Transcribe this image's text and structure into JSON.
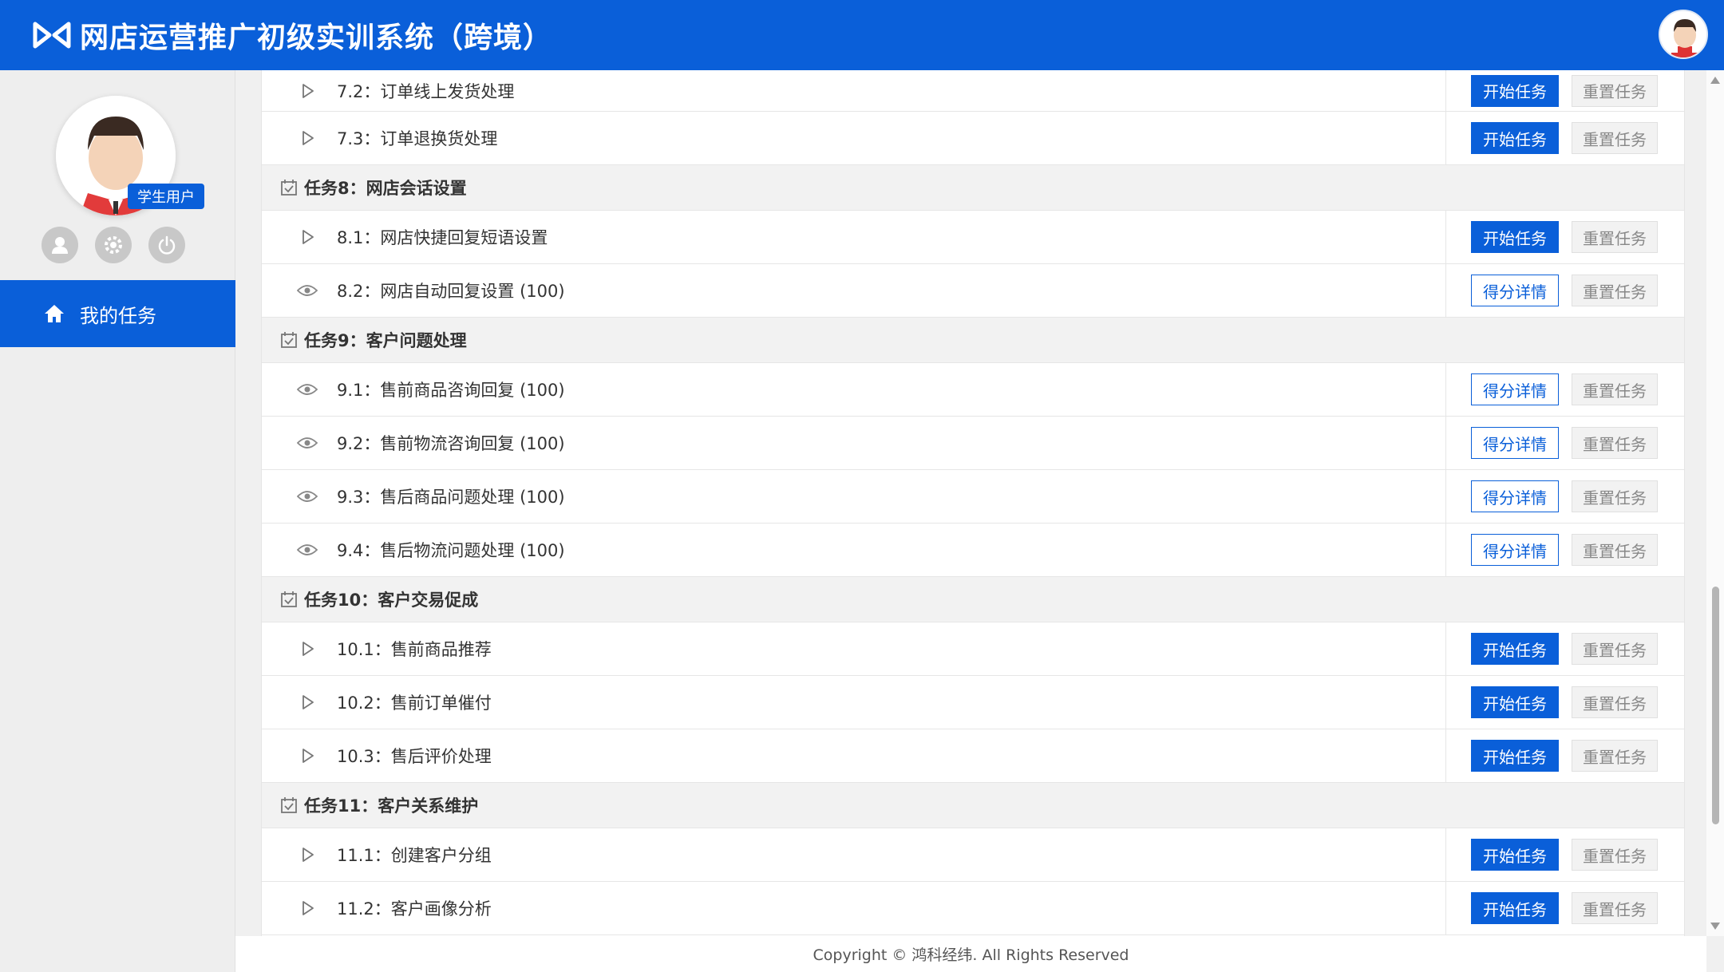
{
  "app": {
    "title": "网店运营推广初级实训系统（跨境）"
  },
  "user": {
    "role_badge": "学生用户"
  },
  "sidebar": {
    "nav_label": "我的任务"
  },
  "colors": {
    "primary": "#0a5fd9",
    "group_bg": "#f2f2f2"
  },
  "rows": [
    {
      "type": "task",
      "label": "7.2：订单线上发货处理",
      "icon": "play-icon",
      "action": "开始任务",
      "action_style": "primary",
      "reset": "重置任务"
    },
    {
      "type": "task",
      "label": "7.3：订单退换货处理",
      "icon": "play-icon",
      "action": "开始任务",
      "action_style": "primary",
      "reset": "重置任务"
    },
    {
      "type": "group",
      "label": "任务8：网店会话设置",
      "icon": "calendar-check-icon"
    },
    {
      "type": "task",
      "label": "8.1：网店快捷回复短语设置",
      "icon": "play-icon",
      "action": "开始任务",
      "action_style": "primary",
      "reset": "重置任务"
    },
    {
      "type": "task",
      "label": "8.2：网店自动回复设置 (100)",
      "icon": "eye-icon",
      "action": "得分详情",
      "action_style": "outline",
      "reset": "重置任务"
    },
    {
      "type": "group",
      "label": "任务9：客户问题处理",
      "icon": "calendar-check-icon"
    },
    {
      "type": "task",
      "label": "9.1：售前商品咨询回复 (100)",
      "icon": "eye-icon",
      "action": "得分详情",
      "action_style": "outline",
      "reset": "重置任务"
    },
    {
      "type": "task",
      "label": "9.2：售前物流咨询回复 (100)",
      "icon": "eye-icon",
      "action": "得分详情",
      "action_style": "outline",
      "reset": "重置任务"
    },
    {
      "type": "task",
      "label": "9.3：售后商品问题处理 (100)",
      "icon": "eye-icon",
      "action": "得分详情",
      "action_style": "outline",
      "reset": "重置任务"
    },
    {
      "type": "task",
      "label": "9.4：售后物流问题处理 (100)",
      "icon": "eye-icon",
      "action": "得分详情",
      "action_style": "outline",
      "reset": "重置任务"
    },
    {
      "type": "group",
      "label": "任务10：客户交易促成",
      "icon": "calendar-check-icon"
    },
    {
      "type": "task",
      "label": "10.1：售前商品推荐",
      "icon": "play-icon",
      "action": "开始任务",
      "action_style": "primary",
      "reset": "重置任务"
    },
    {
      "type": "task",
      "label": "10.2：售前订单催付",
      "icon": "play-icon",
      "action": "开始任务",
      "action_style": "primary",
      "reset": "重置任务"
    },
    {
      "type": "task",
      "label": "10.3：售后评价处理",
      "icon": "play-icon",
      "action": "开始任务",
      "action_style": "primary",
      "reset": "重置任务"
    },
    {
      "type": "group",
      "label": "任务11：客户关系维护",
      "icon": "calendar-check-icon"
    },
    {
      "type": "task",
      "label": "11.1：创建客户分组",
      "icon": "play-icon",
      "action": "开始任务",
      "action_style": "primary",
      "reset": "重置任务"
    },
    {
      "type": "task",
      "label": "11.2：客户画像分析",
      "icon": "play-icon",
      "action": "开始任务",
      "action_style": "primary",
      "reset": "重置任务"
    }
  ],
  "footer": {
    "copyright": "Copyright © 鸿科经纬. All Rights Reserved"
  }
}
